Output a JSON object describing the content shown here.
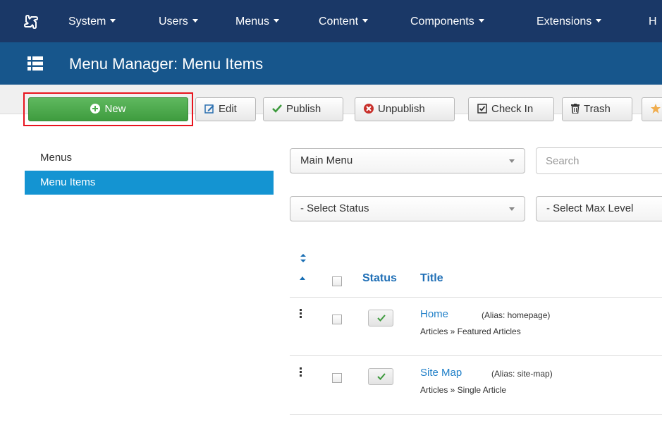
{
  "navbar": {
    "logo_icon": "joomla-logo-icon",
    "items": [
      {
        "label": "System"
      },
      {
        "label": "Users"
      },
      {
        "label": "Menus"
      },
      {
        "label": "Content"
      },
      {
        "label": "Components"
      },
      {
        "label": "Extensions"
      },
      {
        "label": "H"
      }
    ]
  },
  "header": {
    "icon": "list-icon",
    "title": "Menu Manager: Menu Items"
  },
  "toolbar": {
    "new_label": "New",
    "edit_label": "Edit",
    "publish_label": "Publish",
    "unpublish_label": "Unpublish",
    "checkin_label": "Check In",
    "trash_label": "Trash",
    "highlight_color": "#e8141e",
    "new_color": "#4cae4c"
  },
  "sidebar": {
    "items": [
      {
        "label": "Menus",
        "active": false
      },
      {
        "label": "Menu Items",
        "active": true
      }
    ],
    "active_color": "#1494d2"
  },
  "filters": {
    "menu_select": "Main Menu",
    "search_placeholder": "Search",
    "status_select": "- Select Status",
    "max_levels_select": "- Select Max Level"
  },
  "table": {
    "headers": {
      "status": "Status",
      "title": "Title"
    },
    "rows": [
      {
        "title": "Home",
        "alias": "(Alias: homepage)",
        "type": "Articles » Featured Articles",
        "published": true
      },
      {
        "title": "Site Map",
        "alias": "(Alias: site-map)",
        "type": "Articles » Single Article",
        "published": true
      }
    ]
  }
}
